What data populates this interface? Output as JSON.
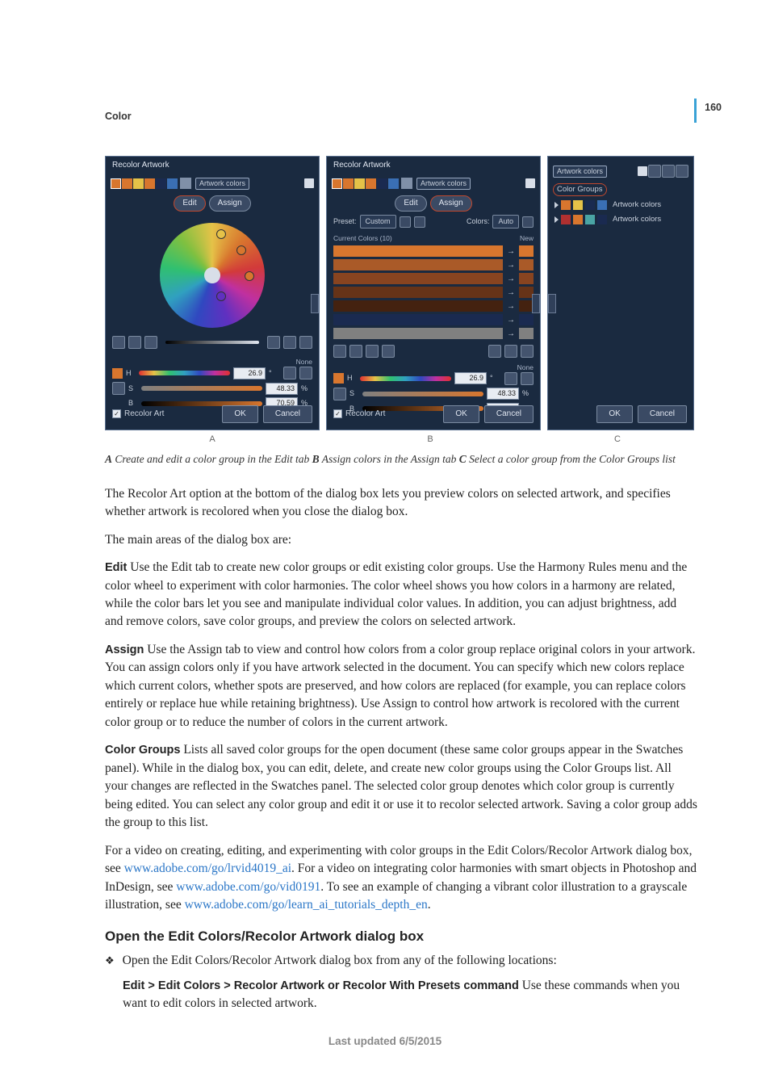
{
  "page": {
    "number": "160",
    "section": "Color"
  },
  "figure": {
    "panel_title": "Recolor Artwork",
    "swatch_label": "Artwork colors",
    "tabs": {
      "edit": "Edit",
      "assign": "Assign"
    },
    "preset": {
      "label": "Preset:",
      "value": "Custom",
      "colors_label": "Colors:",
      "colors_mode": "Auto"
    },
    "current_colors": "Current Colors (10)",
    "new_label": "New",
    "hsb": {
      "h_lbl": "H",
      "h_val": "26.9",
      "h_unit": "°",
      "s_lbl": "S",
      "s_val": "48.33",
      "s_unit": "%",
      "b_lbl": "B",
      "b_val": "70.59",
      "b_unit": "%",
      "none": "None"
    },
    "recolor_label": "Recolor Art",
    "ok": "OK",
    "cancel": "Cancel",
    "color_groups_label": "Color Groups",
    "cg_item_label": "Artwork colors",
    "letters": {
      "a": "A",
      "b": "B",
      "c": "C"
    },
    "caption": {
      "a_bold": "A",
      "a_text": " Create and edit a color group in the Edit tab  ",
      "b_bold": "B",
      "b_text": " Assign colors in the Assign tab  ",
      "c_bold": "C",
      "c_text": " Select a color group from the Color Groups list"
    }
  },
  "body": {
    "p1": "The Recolor Art option at the bottom of the dialog box lets you preview colors on selected artwork, and specifies whether artwork is recolored when you close the dialog box.",
    "p2": "The main areas of the dialog box are:",
    "edit_term": "Edit",
    "edit_text": "  Use the Edit tab to create new color groups or edit existing color groups. Use the Harmony Rules menu and the color wheel to experiment with color harmonies. The color wheel shows you how colors in a harmony are related, while the color bars let you see and manipulate individual color values. In addition, you can adjust brightness, add and remove colors, save color groups, and preview the colors on selected artwork.",
    "assign_term": "Assign",
    "assign_text": "  Use the Assign tab to view and control how colors from a color group replace original colors in your artwork. You can assign colors only if you have artwork selected in the document. You can specify which new colors replace which current colors, whether spots are preserved, and how colors are replaced (for example, you can replace colors entirely or replace hue while retaining brightness). Use Assign to control how artwork is recolored with the current color group or to reduce the number of colors in the current artwork.",
    "cg_term": "Color Groups",
    "cg_text": "  Lists all saved color groups for the open document (these same color groups appear in the Swatches panel). While in the dialog box, you can edit, delete, and create new color groups using the Color Groups list. All your changes are reflected in the Swatches panel. The selected color group denotes which color group is currently being edited. You can select any color group and edit it or use it to recolor selected artwork. Saving a color group adds the group to this list.",
    "vid_pre": "For a video on creating, editing, and experimenting with color groups in the Edit Colors/Recolor Artwork dialog box, see ",
    "link1": "www.adobe.com/go/lrvid4019_ai",
    "vid_mid": ". For a video on integrating color harmonies with smart objects in Photoshop and InDesign, see ",
    "link2": "www.adobe.com/go/vid0191",
    "vid_mid2": ". To see an example of changing a vibrant color illustration to a grayscale illustration, see ",
    "link3": "www.adobe.com/go/learn_ai_tutorials_depth_en",
    "vid_end": ".",
    "subhead": "Open the Edit Colors/Recolor Artwork dialog box",
    "bullet_text": "Open the Edit Colors/Recolor Artwork dialog box from any of the following locations:",
    "cmd_term": "Edit > Edit Colors > Recolor Artwork or Recolor With Presets command",
    "cmd_text": "  Use these commands when you want to edit colors in selected artwork."
  },
  "footer": "Last updated 6/5/2015"
}
